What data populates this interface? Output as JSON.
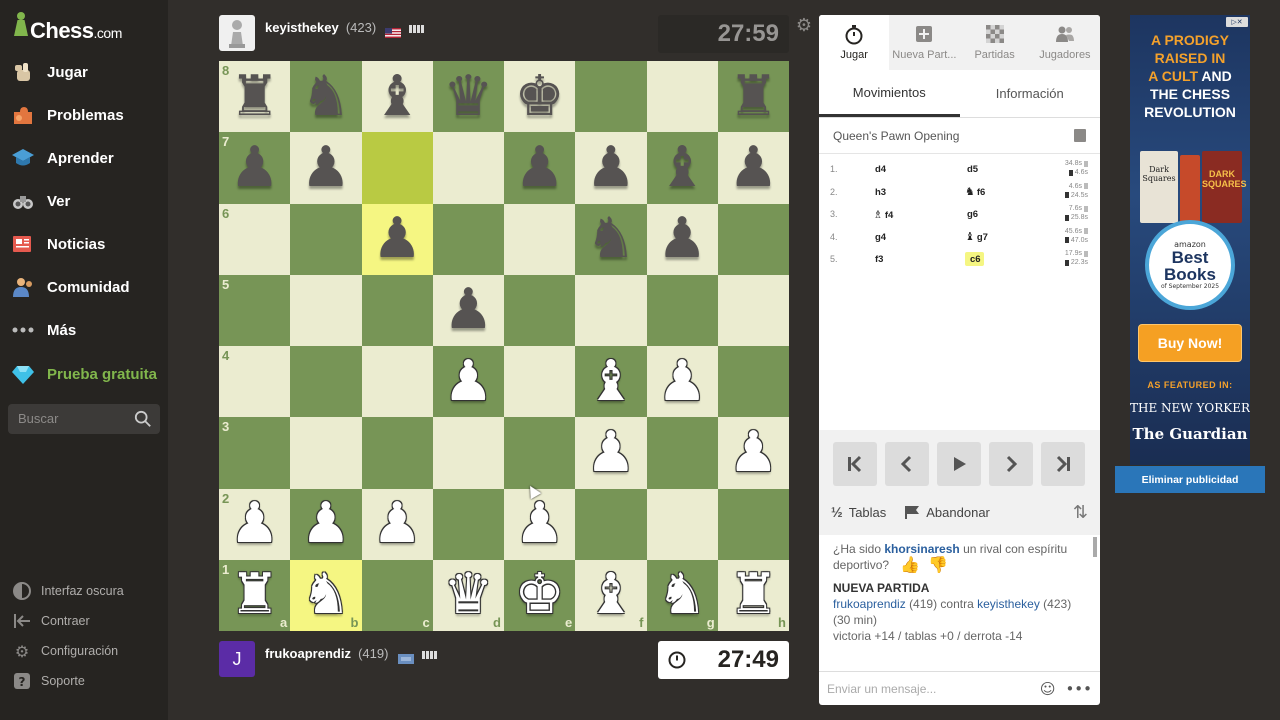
{
  "app": {
    "logo_text": "Chess",
    "logo_suffix": ".com"
  },
  "sidebar": {
    "items": [
      {
        "label": "Jugar",
        "icon": "play-hand-icon"
      },
      {
        "label": "Problemas",
        "icon": "puzzle-icon"
      },
      {
        "label": "Aprender",
        "icon": "learn-icon"
      },
      {
        "label": "Ver",
        "icon": "binoculars-icon"
      },
      {
        "label": "Noticias",
        "icon": "news-icon"
      },
      {
        "label": "Comunidad",
        "icon": "community-icon"
      },
      {
        "label": "Más",
        "icon": "more-dots-icon"
      },
      {
        "label": "Prueba gratuita",
        "icon": "diamond-icon"
      }
    ],
    "search_placeholder": "Buscar",
    "bottom": [
      {
        "label": "Interfaz oscura",
        "icon": "dark-mode-icon"
      },
      {
        "label": "Contraer",
        "icon": "collapse-icon"
      },
      {
        "label": "Configuración",
        "icon": "settings-icon"
      },
      {
        "label": "Soporte",
        "icon": "support-icon"
      }
    ]
  },
  "top_player": {
    "name": "keyisthekey",
    "rating": "(423)",
    "clock": "27:59"
  },
  "bottom_player": {
    "name": "frukoaprendiz",
    "rating": "(419)",
    "avatar_letter": "J",
    "clock": "27:49"
  },
  "board": {
    "rows": [
      [
        "bR",
        "bN",
        "bB",
        "bQ",
        "bK",
        "",
        "",
        "bR"
      ],
      [
        "bP",
        "bP",
        "",
        "",
        "bP",
        "bP",
        "bB",
        "bP"
      ],
      [
        "",
        "",
        "bP",
        "",
        "",
        "bN",
        "bP",
        ""
      ],
      [
        "",
        "",
        "",
        "bP",
        "",
        "",
        "",
        ""
      ],
      [
        "",
        "",
        "",
        "wP",
        "",
        "wB",
        "wP",
        ""
      ],
      [
        "",
        "",
        "",
        "",
        "",
        "wP",
        "",
        "wP"
      ],
      [
        "wP",
        "wP",
        "wP",
        "",
        "wP",
        "",
        "",
        ""
      ],
      [
        "wR",
        "wN",
        "",
        "wQ",
        "wK",
        "wB",
        "wN",
        "wR"
      ]
    ],
    "highlights": [
      "c7",
      "c6",
      "b1"
    ],
    "ranks": [
      "8",
      "7",
      "6",
      "5",
      "4",
      "3",
      "2",
      "1"
    ],
    "files": [
      "a",
      "b",
      "c",
      "d",
      "e",
      "f",
      "g",
      "h"
    ]
  },
  "panel": {
    "tabs": [
      {
        "label": "Jugar",
        "icon": "stopwatch-icon"
      },
      {
        "label": "Nueva Part...",
        "icon": "new-game-icon"
      },
      {
        "label": "Partidas",
        "icon": "board-icon"
      },
      {
        "label": "Jugadores",
        "icon": "players-icon"
      }
    ],
    "subtabs": [
      "Movimientos",
      "Información"
    ],
    "opening": "Queen's Pawn Opening",
    "moves": [
      {
        "num": "1.",
        "white": "d4",
        "black": "d5",
        "wp": "",
        "bp": "",
        "t1": "34.8s",
        "t2": "4.6s"
      },
      {
        "num": "2.",
        "white": "h3",
        "black": "f6",
        "wp": "",
        "bp": "♞",
        "t1": "4.6s",
        "t2": "24.5s"
      },
      {
        "num": "3.",
        "white": "f4",
        "black": "g6",
        "wp": "♗",
        "bp": "",
        "t1": "7.6s",
        "t2": "25.8s"
      },
      {
        "num": "4.",
        "white": "g4",
        "black": "g7",
        "wp": "",
        "bp": "♝",
        "t1": "45.6s",
        "t2": "47.0s"
      },
      {
        "num": "5.",
        "white": "f3",
        "black": "c6",
        "wp": "",
        "bp": "",
        "t1": "17.9s",
        "t2": "22.3s"
      }
    ],
    "draw_label": "Tablas",
    "draw_symbol": "½",
    "resign_label": "Abandonar",
    "chat": {
      "line1_pre": "¿Ha sido",
      "line1_user": "khorsinaresh",
      "line1_post": "un rival con espíritu deportivo?",
      "new_game_title": "NUEVA PARTIDA",
      "ng_user1": "frukoaprendiz",
      "ng_rating1": "(419)",
      "ng_vs": "contra",
      "ng_user2": "keyisthekey",
      "ng_rating2": "(423) (30 min)",
      "ng_result": "victoria +14 / tablas +0 / derrota -14"
    },
    "message_placeholder": "Enviar un mensaje..."
  },
  "ad": {
    "headline_1": "A PRODIGY",
    "headline_2": "RAISED IN",
    "headline_3": "A CULT",
    "headline_4": "AND",
    "headline_5": "THE CHESS",
    "headline_6": "REVOLUTION",
    "book1": "Dark Squares",
    "book2": "DARK SQUARES",
    "seal_top": "amazon",
    "seal_main": "Best Books",
    "seal_sub": "of September 2025",
    "buy": "Buy Now!",
    "featured": "AS FEATURED IN:",
    "pub1": "THE NEW YORKER",
    "pub2": "The Guardian",
    "remove": "Eliminar publicidad"
  },
  "colors": {
    "board_light": "#ebecd0",
    "board_dark": "#779556",
    "highlight": "#f5f682",
    "brand_green": "#81b64c"
  }
}
